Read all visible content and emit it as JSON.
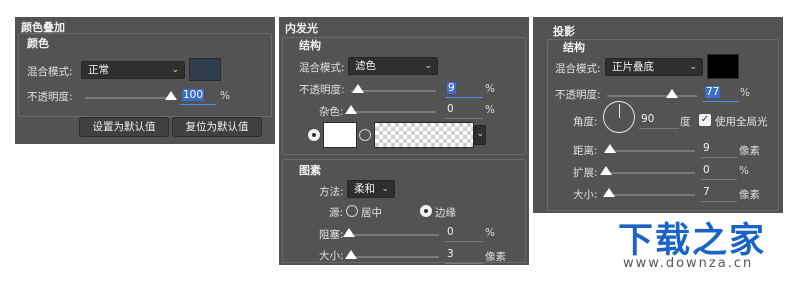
{
  "color_overlay": {
    "title": "颜色叠加",
    "section": "颜色",
    "blend_label": "混合模式:",
    "blend_value": "正常",
    "opacity_label": "不透明度:",
    "opacity_value": "100",
    "opacity_unit": "%",
    "opacity_level_percent": 100,
    "swatch_color": "#2f3d4d",
    "set_default_button": "设置为默认值",
    "reset_default_button": "复位为默认值"
  },
  "inner_glow": {
    "title": "内发光",
    "structure_label": "结构",
    "blend_label": "混合模式:",
    "blend_value": "滤色",
    "opacity_label": "不透明度:",
    "opacity_value": "9",
    "opacity_unit": "%",
    "opacity_level_percent": 9,
    "noise_label": "杂色:",
    "noise_value": "0",
    "noise_unit": "%",
    "noise_level_percent": 0,
    "glow_color": "#ffffff",
    "elements_label": "图素",
    "method_label": "方法:",
    "method_value": "柔和",
    "source_label": "源:",
    "source_center": "居中",
    "source_edge": "边缘",
    "source_selected": "边缘",
    "choke_label": "阻塞:",
    "choke_value": "0",
    "choke_unit": "%",
    "choke_level_percent": 0,
    "size_label": "大小:",
    "size_value": "3",
    "size_unit": "像素",
    "size_level_percent": 2
  },
  "drop_shadow": {
    "title": "投影",
    "structure_label": "结构",
    "blend_label": "混合模式:",
    "blend_value": "正片叠底",
    "swatch_color": "#000000",
    "opacity_label": "不透明度:",
    "opacity_value": "77",
    "opacity_unit": "%",
    "opacity_level_percent": 77,
    "angle_label": "角度:",
    "angle_value": "90",
    "angle_unit": "度",
    "global_light_label": "使用全局光",
    "global_light_checked": true,
    "distance_label": "距离:",
    "distance_value": "9",
    "distance_unit": "像素",
    "distance_level_percent": 5,
    "spread_label": "扩展:",
    "spread_value": "0",
    "spread_unit": "%",
    "spread_level_percent": 0,
    "size_label": "大小:",
    "size_value": "7",
    "size_unit": "像素",
    "size_level_percent": 4
  },
  "watermark": {
    "brand": "下载之家",
    "url": "www.downza.cn"
  },
  "icons": {
    "dropdown": "chevron-down-icon",
    "checkbox": "checkmark-icon",
    "dial": "angle-dial-icon"
  }
}
